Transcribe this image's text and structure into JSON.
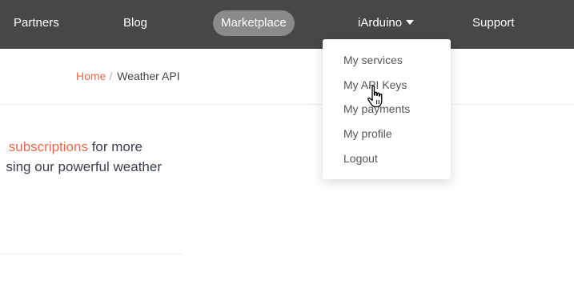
{
  "nav": {
    "partners": "Partners",
    "blog": "Blog",
    "marketplace": "Marketplace",
    "user": "iArduino",
    "support": "Support"
  },
  "breadcrumb": {
    "home": "Home",
    "separator": "/",
    "current": "Weather API"
  },
  "intro": {
    "link": "subscriptions",
    "line1_rest": " for more",
    "line2": "sing our powerful weather"
  },
  "dropdown": {
    "items": [
      {
        "label": "My services"
      },
      {
        "label": "My API Keys"
      },
      {
        "label": "My payments"
      },
      {
        "label": "My profile"
      },
      {
        "label": "Logout"
      }
    ]
  },
  "colors": {
    "topbar": "#474747",
    "accent": "#e8684a",
    "marketplace_pill": "#8a8a8a"
  },
  "icons": {
    "user_menu": "caret-down-icon",
    "pointer": "hand-pointer-icon"
  }
}
